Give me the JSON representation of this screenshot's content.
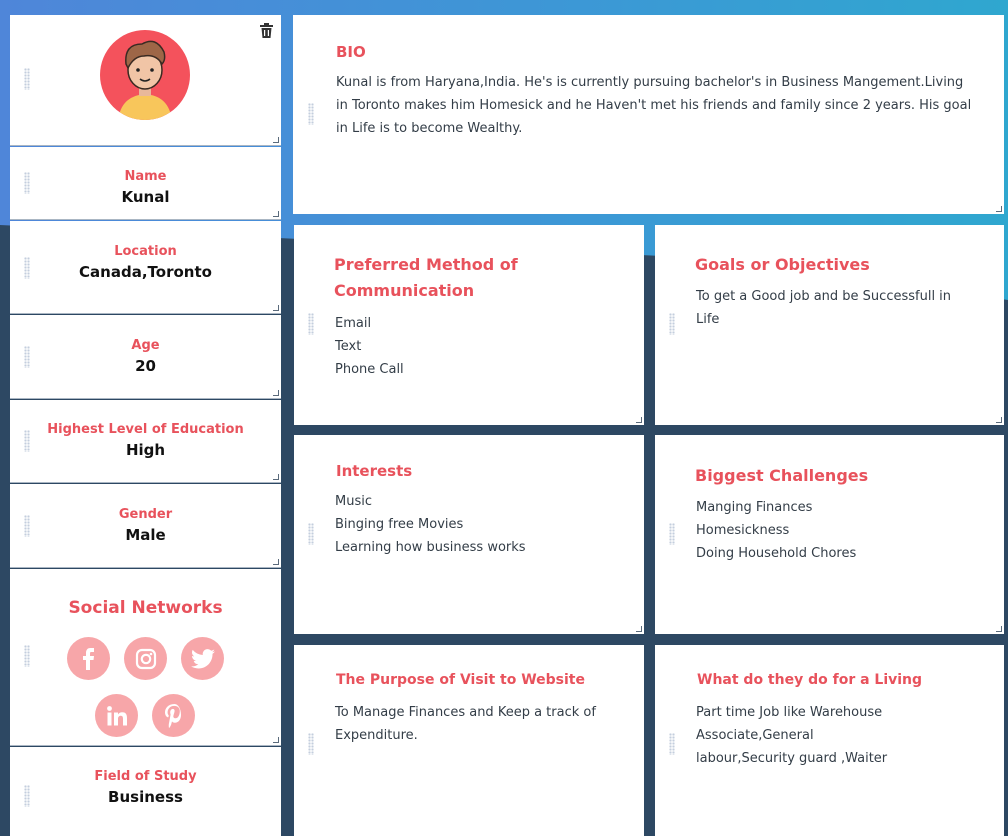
{
  "profile": {
    "name_label": "Name",
    "name_value": "Kunal",
    "location_label": "Location",
    "location_value": "Canada,Toronto",
    "age_label": "Age",
    "age_value": "20",
    "education_label": "Highest Level of Education",
    "education_value": "High",
    "gender_label": "Gender",
    "gender_value": "Male",
    "field_label": "Field of Study",
    "field_value": "Business"
  },
  "social": {
    "title": "Social Networks",
    "icons": [
      "facebook-icon",
      "instagram-icon",
      "twitter-icon",
      "linkedin-icon",
      "pinterest-icon"
    ]
  },
  "bio": {
    "title": "BIO",
    "text": "Kunal is from Haryana,India. He's is currently pursuing bachelor's in Business Mangement.Living in Toronto makes him Homesick and he Haven't met his friends and family since 2 years. His goal in Life is to become Wealthy."
  },
  "communication": {
    "title": "Preferred Method of Communication",
    "items": [
      "Email",
      "Text",
      "Phone Call"
    ]
  },
  "goals": {
    "title": "Goals or Objectives",
    "items": [
      "To get a Good job and be Successfull in Life"
    ]
  },
  "interests": {
    "title": "Interests",
    "items": [
      "Music",
      "Binging free Movies",
      "Learning how business works"
    ]
  },
  "challenges": {
    "title": "Biggest Challenges",
    "items": [
      "Manging Finances",
      "Homesickness",
      "Doing Household Chores"
    ]
  },
  "purpose": {
    "title": "The Purpose of Visit to Website",
    "items": [
      "To Manage Finances and Keep a track of Expenditure."
    ]
  },
  "living": {
    "title": "What do they do for a Living",
    "items": [
      "Part time Job like Warehouse Associate,General labour,Security guard ,Waiter"
    ]
  },
  "colors": {
    "accent": "#e8525c",
    "social_bg": "#f7a6a9",
    "page_bg": "#2d4863"
  }
}
